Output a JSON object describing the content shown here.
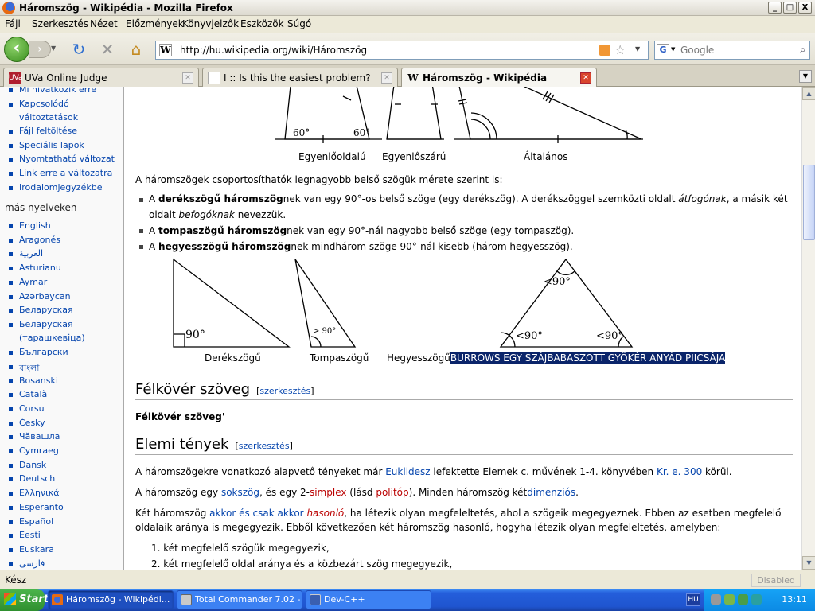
{
  "window": {
    "title": "Háromszög - Wikipédia - Mozilla Firefox",
    "buttons": {
      "minimize": "_",
      "maximize": "□",
      "close": "X"
    }
  },
  "menu": [
    "Fájl",
    "Szerkesztés",
    "Nézet",
    "Előzmények",
    "Könyvjelzők",
    "Eszközök",
    "Súgó"
  ],
  "nav": {
    "url": "http://hu.wikipedia.org/wiki/Háromszög",
    "search_placeholder": "Google"
  },
  "tabs": [
    {
      "label": "UVa Online Judge",
      "icon": "UVa",
      "active": false
    },
    {
      "label": "I :: Is this the easiest problem?",
      "icon": "page",
      "active": false
    },
    {
      "label": "Háromszög - Wikipédia",
      "icon": "W",
      "active": true
    }
  ],
  "sidebar": {
    "toolbox": [
      "Mi hivatkozik erre",
      "Kapcsolódó",
      "változtatások",
      "Fájl feltöltése",
      "Speciális lapok",
      "Nyomtatható változat",
      "Link erre a változatra",
      "Irodalomjegyzékbe"
    ],
    "languages_heading": "más nyelveken",
    "languages": [
      "English",
      "Aragonés",
      "العربية",
      "Asturianu",
      "Aymar",
      "Azərbaycan",
      "Беларуская",
      "Беларуская",
      "(тарашкевіца)",
      "Български",
      "বাংলা",
      "Bosanski",
      "Català",
      "Corsu",
      "Česky",
      "Чӑвашла",
      "Cymraeg",
      "Dansk",
      "Deutsch",
      "Ελληνικά",
      "Esperanto",
      "Español",
      "Eesti",
      "Euskara",
      "فارسی"
    ]
  },
  "figure1": {
    "captions": [
      "Egyenlőoldalú",
      "Egyenlőszárú",
      "Általános"
    ],
    "angles": [
      "60°",
      "60°"
    ]
  },
  "text": {
    "intro": "A háromszögek csoportosíthatók legnagyobb belső szögük mérete szerint is:",
    "b1_bold": "derékszögű háromszög",
    "b1_rest": "nek van egy 90°-os belső szöge (egy derékszög). A derékszöggel szemközti oldalt ",
    "b1_italic1": "átfogónak",
    "b1_rest2": ", a másik két",
    "b1_line2a": "oldalt ",
    "b1_italic2": "befogóknak",
    "b1_line2b": " nevezzük.",
    "b2_bold": "tompaszögű háromszög",
    "b2_rest": "nek van egy 90°-nál nagyobb belső szöge (egy tompaszög).",
    "b3_bold": "hegyesszögű háromszög",
    "b3_rest": "nek mindhárom szöge 90°-nál kisebb (három hegyesszög).",
    "article_a": "A "
  },
  "figure2": {
    "captions": [
      "Derékszögű",
      "Tompaszögű",
      "Hegyesszögű"
    ],
    "selected": "BURROWS EGY SZÁJBABASZOTT GYÖKÉR ANYÁD PIICSÁJA",
    "angles": [
      "90°",
      "> 90°",
      "<90°",
      "<90°",
      "<90°"
    ]
  },
  "section1": {
    "heading": "Félkövér szöveg",
    "edit": "[szerkesztés]",
    "body": "Félkövér szöveg'"
  },
  "section2": {
    "heading": "Elemi tények",
    "edit": "[szerkesztés]",
    "p1a": "A háromszögekre vonatkozó alapvető tényeket már ",
    "p1_link1": "Euklidesz",
    "p1b": " lefektette Elemek c. művének 1-4. könyvében ",
    "p1_link2": "Kr. e. 300",
    "p1c": " körül.",
    "p2a": "A háromszög egy ",
    "p2_link1": "sokszög",
    "p2b": ", és egy 2-",
    "p2_link2": "simplex",
    "p2c": " (lásd ",
    "p2_link3": "politóp",
    "p2d": "). Minden háromszög két",
    "p2_link4": "dimenziós",
    "p2e": ".",
    "p3a": "Két háromszög ",
    "p3_link1": "akkor és csak akkor",
    "p3_space": " ",
    "p3_link2": "hasonló",
    "p3b": ", ha létezik olyan megfeleltetés, ahol a szögeik megegyeznek. Ebben az esetben megfelelő",
    "p3_line2": "oldalaik aránya is megegyezik. Ebből következően két háromszög hasonló, hogyha létezik olyan megfeleltetés, amelyben:",
    "ol": [
      "1.  két megfelelő szögük megegyezik,",
      "2.  két megfelelő oldal aránya és a közbezárt szög megegyezik,"
    ]
  },
  "status": {
    "left": "Kész",
    "right": "Disabled"
  },
  "taskbar": {
    "start": "Start",
    "tasks": [
      "Háromszög - Wikipédi...",
      "Total Commander 7.02 - ...",
      "Dev-C++"
    ],
    "lang": "HU",
    "clock": "13:11"
  }
}
